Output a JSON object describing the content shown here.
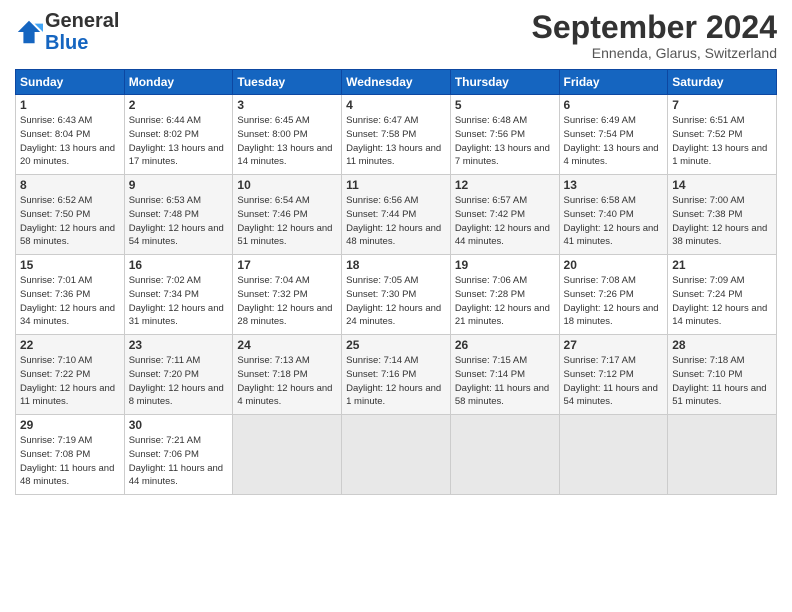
{
  "header": {
    "logo_general": "General",
    "logo_blue": "Blue",
    "month_title": "September 2024",
    "subtitle": "Ennenda, Glarus, Switzerland"
  },
  "weekdays": [
    "Sunday",
    "Monday",
    "Tuesday",
    "Wednesday",
    "Thursday",
    "Friday",
    "Saturday"
  ],
  "weeks": [
    [
      {
        "day": "1",
        "sunrise": "6:43 AM",
        "sunset": "8:04 PM",
        "daylight": "13 hours and 20 minutes."
      },
      {
        "day": "2",
        "sunrise": "6:44 AM",
        "sunset": "8:02 PM",
        "daylight": "13 hours and 17 minutes."
      },
      {
        "day": "3",
        "sunrise": "6:45 AM",
        "sunset": "8:00 PM",
        "daylight": "13 hours and 14 minutes."
      },
      {
        "day": "4",
        "sunrise": "6:47 AM",
        "sunset": "7:58 PM",
        "daylight": "13 hours and 11 minutes."
      },
      {
        "day": "5",
        "sunrise": "6:48 AM",
        "sunset": "7:56 PM",
        "daylight": "13 hours and 7 minutes."
      },
      {
        "day": "6",
        "sunrise": "6:49 AM",
        "sunset": "7:54 PM",
        "daylight": "13 hours and 4 minutes."
      },
      {
        "day": "7",
        "sunrise": "6:51 AM",
        "sunset": "7:52 PM",
        "daylight": "13 hours and 1 minute."
      }
    ],
    [
      {
        "day": "8",
        "sunrise": "6:52 AM",
        "sunset": "7:50 PM",
        "daylight": "12 hours and 58 minutes."
      },
      {
        "day": "9",
        "sunrise": "6:53 AM",
        "sunset": "7:48 PM",
        "daylight": "12 hours and 54 minutes."
      },
      {
        "day": "10",
        "sunrise": "6:54 AM",
        "sunset": "7:46 PM",
        "daylight": "12 hours and 51 minutes."
      },
      {
        "day": "11",
        "sunrise": "6:56 AM",
        "sunset": "7:44 PM",
        "daylight": "12 hours and 48 minutes."
      },
      {
        "day": "12",
        "sunrise": "6:57 AM",
        "sunset": "7:42 PM",
        "daylight": "12 hours and 44 minutes."
      },
      {
        "day": "13",
        "sunrise": "6:58 AM",
        "sunset": "7:40 PM",
        "daylight": "12 hours and 41 minutes."
      },
      {
        "day": "14",
        "sunrise": "7:00 AM",
        "sunset": "7:38 PM",
        "daylight": "12 hours and 38 minutes."
      }
    ],
    [
      {
        "day": "15",
        "sunrise": "7:01 AM",
        "sunset": "7:36 PM",
        "daylight": "12 hours and 34 minutes."
      },
      {
        "day": "16",
        "sunrise": "7:02 AM",
        "sunset": "7:34 PM",
        "daylight": "12 hours and 31 minutes."
      },
      {
        "day": "17",
        "sunrise": "7:04 AM",
        "sunset": "7:32 PM",
        "daylight": "12 hours and 28 minutes."
      },
      {
        "day": "18",
        "sunrise": "7:05 AM",
        "sunset": "7:30 PM",
        "daylight": "12 hours and 24 minutes."
      },
      {
        "day": "19",
        "sunrise": "7:06 AM",
        "sunset": "7:28 PM",
        "daylight": "12 hours and 21 minutes."
      },
      {
        "day": "20",
        "sunrise": "7:08 AM",
        "sunset": "7:26 PM",
        "daylight": "12 hours and 18 minutes."
      },
      {
        "day": "21",
        "sunrise": "7:09 AM",
        "sunset": "7:24 PM",
        "daylight": "12 hours and 14 minutes."
      }
    ],
    [
      {
        "day": "22",
        "sunrise": "7:10 AM",
        "sunset": "7:22 PM",
        "daylight": "12 hours and 11 minutes."
      },
      {
        "day": "23",
        "sunrise": "7:11 AM",
        "sunset": "7:20 PM",
        "daylight": "12 hours and 8 minutes."
      },
      {
        "day": "24",
        "sunrise": "7:13 AM",
        "sunset": "7:18 PM",
        "daylight": "12 hours and 4 minutes."
      },
      {
        "day": "25",
        "sunrise": "7:14 AM",
        "sunset": "7:16 PM",
        "daylight": "12 hours and 1 minute."
      },
      {
        "day": "26",
        "sunrise": "7:15 AM",
        "sunset": "7:14 PM",
        "daylight": "11 hours and 58 minutes."
      },
      {
        "day": "27",
        "sunrise": "7:17 AM",
        "sunset": "7:12 PM",
        "daylight": "11 hours and 54 minutes."
      },
      {
        "day": "28",
        "sunrise": "7:18 AM",
        "sunset": "7:10 PM",
        "daylight": "11 hours and 51 minutes."
      }
    ],
    [
      {
        "day": "29",
        "sunrise": "7:19 AM",
        "sunset": "7:08 PM",
        "daylight": "11 hours and 48 minutes."
      },
      {
        "day": "30",
        "sunrise": "7:21 AM",
        "sunset": "7:06 PM",
        "daylight": "11 hours and 44 minutes."
      },
      null,
      null,
      null,
      null,
      null
    ]
  ]
}
